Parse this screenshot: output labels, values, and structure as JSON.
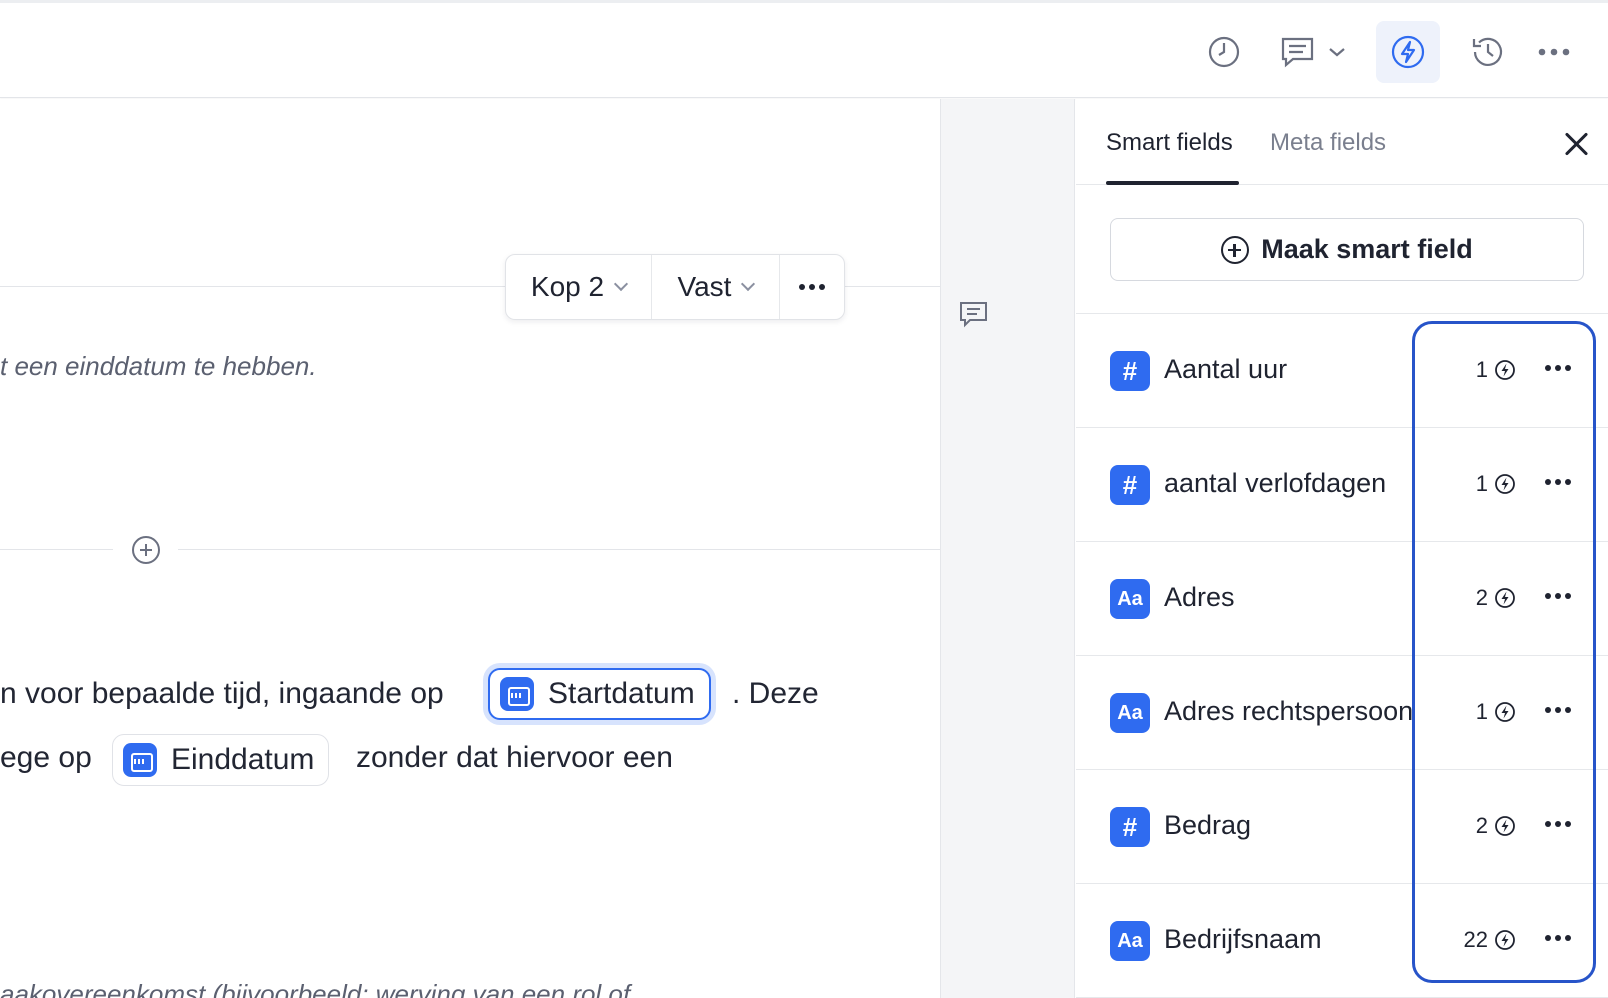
{
  "toolbar": {
    "icons": [
      "clock-icon",
      "comment-icon",
      "chevron-down-icon",
      "lightning-icon",
      "history-icon",
      "more-icon"
    ],
    "accent_color": "#2f6bf0"
  },
  "block_toolbar": {
    "style_label": "Kop 2",
    "mode_label": "Vast"
  },
  "document": {
    "italic_line_1": "t een einddatum te hebben.",
    "line_1_before": "n voor bepaalde tijd, ingaande op",
    "chip_start": "Startdatum",
    "line_1_after": ". Deze",
    "line_2_before": "ege op",
    "chip_end": "Einddatum",
    "line_2_after": "zonder dat hiervoor een",
    "italic_line_2": "aakovereenkomst (bijvoorbeeld: werving van een rol of"
  },
  "panel": {
    "tab_active": "Smart fields",
    "tab_inactive": "Meta fields",
    "make_button": "Maak smart field",
    "fields": [
      {
        "icon": "#",
        "type": "number",
        "name": "Aantal uur",
        "count": "1"
      },
      {
        "icon": "#",
        "type": "number",
        "name": "aantal verlofdagen",
        "count": "1"
      },
      {
        "icon": "Aa",
        "type": "text",
        "name": "Adres",
        "count": "2"
      },
      {
        "icon": "Aa",
        "type": "text",
        "name": "Adres rechtspersoon",
        "count": "1"
      },
      {
        "icon": "#",
        "type": "number",
        "name": "Bedrag",
        "count": "2"
      },
      {
        "icon": "Aa",
        "type": "text",
        "name": "Bedrijfsnaam",
        "count": "22"
      }
    ]
  }
}
